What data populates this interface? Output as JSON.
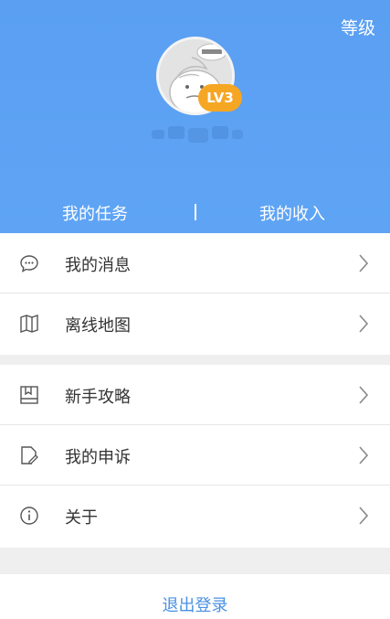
{
  "header": {
    "level_link": "等级",
    "avatar_badge": "LV3",
    "tabs": [
      {
        "label": "我的任务"
      },
      {
        "label": "我的收入"
      }
    ]
  },
  "menu": {
    "group1": [
      {
        "label": "我的消息",
        "icon": "message-icon"
      },
      {
        "label": "离线地图",
        "icon": "map-icon"
      }
    ],
    "group2": [
      {
        "label": "新手攻略",
        "icon": "guide-icon"
      },
      {
        "label": "我的申诉",
        "icon": "appeal-icon"
      },
      {
        "label": "关于",
        "icon": "info-icon"
      }
    ]
  },
  "logout": {
    "label": "退出登录"
  },
  "colors": {
    "header_blue": "#5a9ff2",
    "badge_orange": "#f5a623",
    "logout_blue": "#4a90e2"
  }
}
